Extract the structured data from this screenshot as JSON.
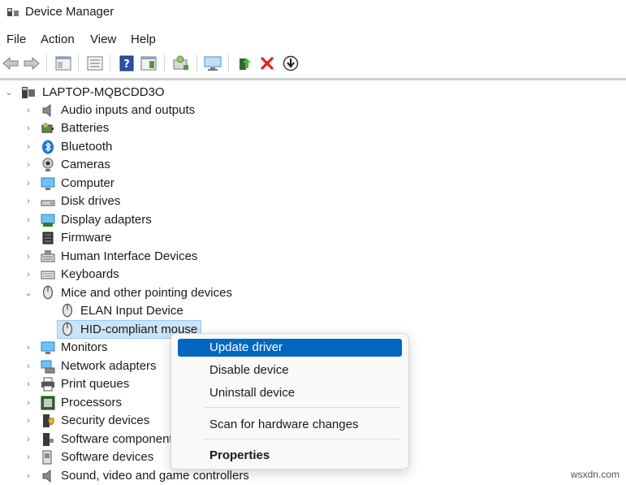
{
  "window": {
    "title": "Device Manager"
  },
  "menu": [
    "File",
    "Action",
    "View",
    "Help"
  ],
  "toolbar": [
    "back-icon",
    "forward-icon",
    "properties-panel-icon",
    "list-view-icon",
    "help-icon",
    "action-pane-icon",
    "scan-hardware-icon",
    "monitor-icon",
    "update-driver-icon",
    "uninstall-icon",
    "download-icon"
  ],
  "tree": {
    "root": "LAPTOP-MQBCDD3O",
    "categories": [
      {
        "label": "Audio inputs and outputs",
        "icon": "speaker-icon"
      },
      {
        "label": "Batteries",
        "icon": "battery-icon"
      },
      {
        "label": "Bluetooth",
        "icon": "bluetooth-icon"
      },
      {
        "label": "Cameras",
        "icon": "camera-icon"
      },
      {
        "label": "Computer",
        "icon": "computer-icon"
      },
      {
        "label": "Disk drives",
        "icon": "disk-drive-icon"
      },
      {
        "label": "Display adapters",
        "icon": "display-adapter-icon"
      },
      {
        "label": "Firmware",
        "icon": "firmware-icon"
      },
      {
        "label": "Human Interface Devices",
        "icon": "hid-icon"
      },
      {
        "label": "Keyboards",
        "icon": "keyboard-icon"
      },
      {
        "label": "Mice and other pointing devices",
        "icon": "mouse-icon",
        "expanded": true,
        "children": [
          {
            "label": "ELAN Input Device",
            "icon": "mouse-icon"
          },
          {
            "label": "HID-compliant mouse",
            "icon": "mouse-icon",
            "selected": true
          }
        ]
      },
      {
        "label": "Monitors",
        "icon": "monitor-icon"
      },
      {
        "label": "Network adapters",
        "icon": "network-adapter-icon"
      },
      {
        "label": "Print queues",
        "icon": "printer-icon"
      },
      {
        "label": "Processors",
        "icon": "processor-icon"
      },
      {
        "label": "Security devices",
        "icon": "security-device-icon"
      },
      {
        "label": "Software component",
        "icon": "software-component-icon"
      },
      {
        "label": "Software devices",
        "icon": "software-device-icon"
      },
      {
        "label": "Sound, video and game controllers",
        "icon": "sound-icon"
      }
    ]
  },
  "context_menu": {
    "items": [
      "Update driver",
      "Disable device",
      "Uninstall device",
      "Scan for hardware changes",
      "Properties"
    ],
    "highlighted": "Update driver",
    "bold": "Properties"
  },
  "watermark": "wsxdn.com",
  "colors": {
    "highlight": "#0067c0",
    "selection": "#cce4f7"
  }
}
